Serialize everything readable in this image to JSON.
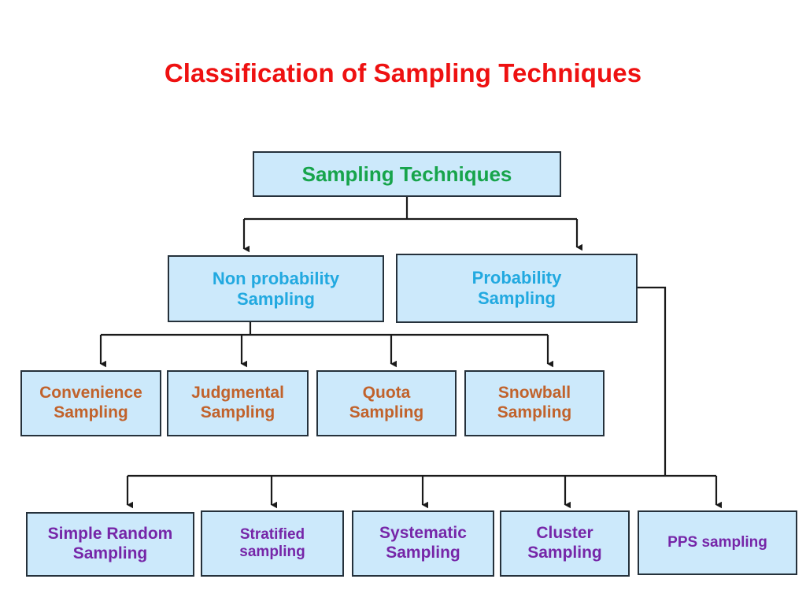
{
  "slide": {
    "title": "Classification of Sampling Techniques",
    "background_color": "#FFFFFF",
    "title_color": "#EE1111"
  },
  "palette": {
    "box_fill": "#CCE9FB",
    "box_border": "#25313B",
    "root_text": "#17A44B",
    "level2_text": "#22A9E0",
    "level3_text": "#C1622B",
    "level4_text": "#7626A8",
    "connector": "#1A1A1A"
  },
  "diagram": {
    "type": "hierarchy-tree",
    "root": {
      "id": "sampling-techniques",
      "label": "Sampling Techniques",
      "text_color": "#17A44B"
    },
    "level2": [
      {
        "id": "non-probability-sampling",
        "line1": "Non probability",
        "line2": "Sampling",
        "text_color": "#22A9E0"
      },
      {
        "id": "probability-sampling",
        "line1": "Probability",
        "line2": "Sampling",
        "text_color": "#22A9E0"
      }
    ],
    "non_probability_children": [
      {
        "id": "convenience-sampling",
        "line1": "Convenience",
        "line2": "Sampling"
      },
      {
        "id": "judgmental-sampling",
        "line1": "Judgmental",
        "line2": "Sampling"
      },
      {
        "id": "quota-sampling",
        "line1": "Quota",
        "line2": "Sampling"
      },
      {
        "id": "snowball-sampling",
        "line1": "Snowball",
        "line2": "Sampling"
      }
    ],
    "probability_children": [
      {
        "id": "simple-random-sampling",
        "line1": "Simple Random",
        "line2": "Sampling"
      },
      {
        "id": "stratified-sampling",
        "line1": "Stratified",
        "line2": "sampling"
      },
      {
        "id": "systematic-sampling",
        "line1": "Systematic",
        "line2": "Sampling"
      },
      {
        "id": "cluster-sampling",
        "line1": "Cluster",
        "line2": "Sampling"
      },
      {
        "id": "pps-sampling",
        "line1": "PPS sampling",
        "line2": ""
      }
    ]
  }
}
